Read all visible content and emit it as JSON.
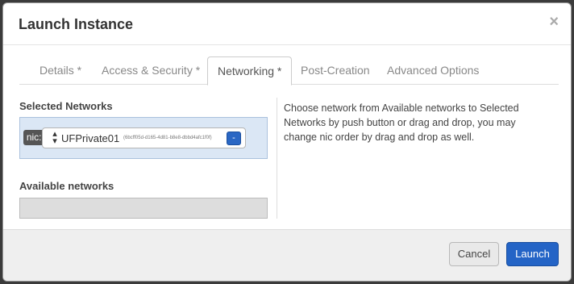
{
  "modal": {
    "title": "Launch Instance",
    "close_symbol": "×"
  },
  "tabs": [
    {
      "label": "Details *",
      "active": false
    },
    {
      "label": "Access & Security *",
      "active": false
    },
    {
      "label": "Networking *",
      "active": true
    },
    {
      "label": "Post-Creation",
      "active": false
    },
    {
      "label": "Advanced Options",
      "active": false
    }
  ],
  "networking": {
    "selected_title": "Selected Networks",
    "selected": [
      {
        "nic_label": "nic:1",
        "name": "UFPrivate01",
        "id": "(6bcff05d-d165-4d81-b8e8-dbbd4afc1f0f)",
        "remove_label": "-"
      }
    ],
    "available_title": "Available networks",
    "help_text": "Choose network from Available networks to Selected Networks by push button or drag and drop, you may change nic order by drag and drop as well."
  },
  "footer": {
    "cancel_label": "Cancel",
    "launch_label": "Launch"
  },
  "colors": {
    "primary": "#2464c6",
    "selected_bg": "#dbe7f5"
  }
}
